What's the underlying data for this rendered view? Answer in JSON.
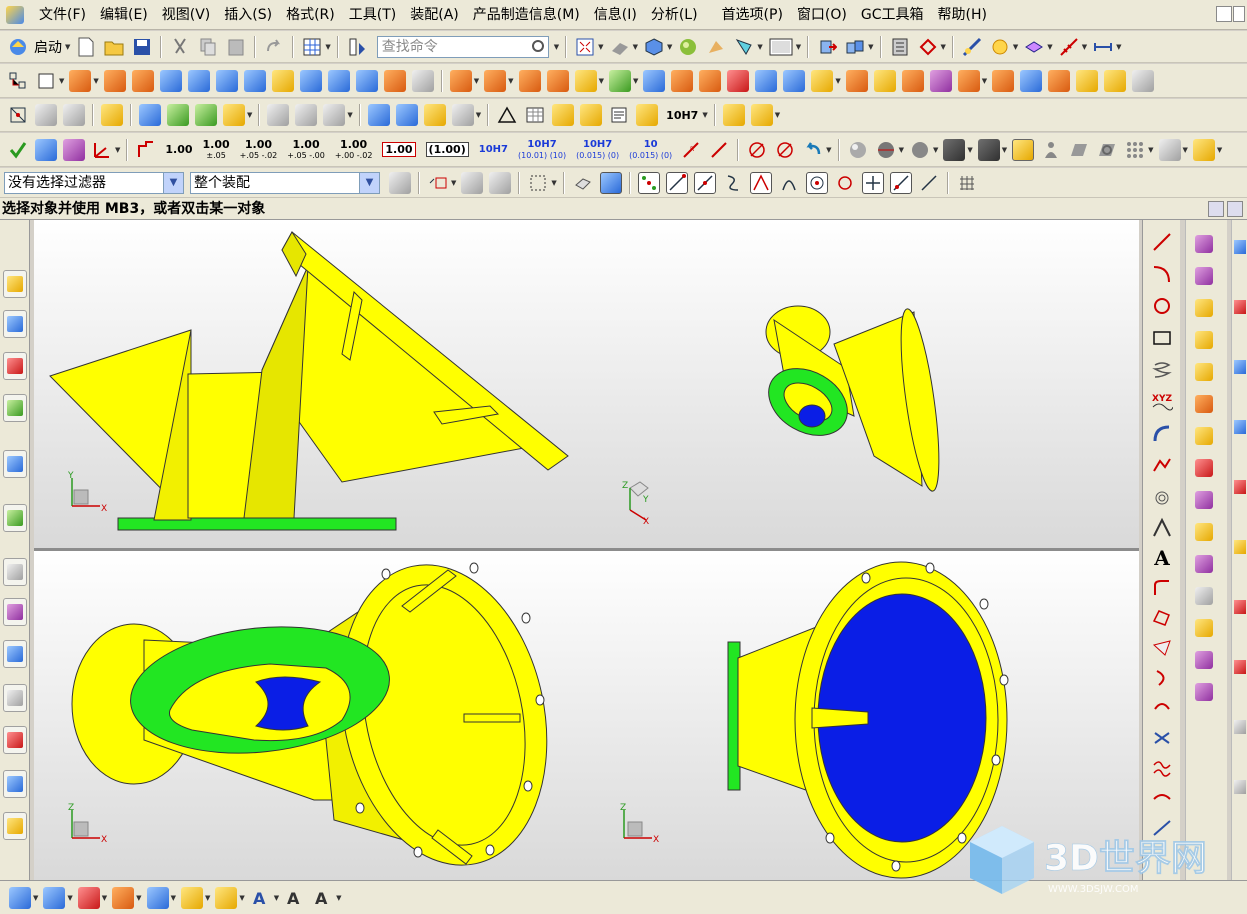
{
  "menubar": {
    "items": [
      "文件(F)",
      "编辑(E)",
      "视图(V)",
      "插入(S)",
      "格式(R)",
      "工具(T)",
      "装配(A)",
      "产品制造信息(M)",
      "信息(I)",
      "分析(L)",
      "首选项(P)",
      "窗口(O)",
      "GC工具箱",
      "帮助(H)"
    ]
  },
  "standard_toolbar": {
    "start_label": "启动",
    "search_placeholder": "查找命令"
  },
  "dimension_toolbar": {
    "labels": [
      "1.00",
      "1.00",
      "1.00",
      "1.00",
      "1.00",
      "1.00",
      "(1.00)",
      "10H7",
      "10H7",
      "10H7",
      "10"
    ],
    "sublabels": [
      "",
      "±.05",
      "+.05 -.02",
      "+.05 -.00",
      "+.00 -.02",
      "",
      "",
      "",
      "(10.01) (10)",
      "(0.015) (0)",
      "(0.015) (0)"
    ],
    "callout_label": "10H7"
  },
  "selection_bar": {
    "filter_value": "没有选择过滤器",
    "scope_value": "整个装配"
  },
  "cue_line": {
    "text": "选择对象并使用 MB3，或者双击某一对象"
  },
  "viewport": {
    "triad_labels": {
      "top_left": [
        "Y",
        "X"
      ],
      "top_right": [
        "Z",
        "Y",
        "X"
      ],
      "bottom_left": [
        "Z",
        "X"
      ],
      "bottom_right": [
        "Z",
        "X"
      ]
    }
  },
  "right_toolbar": {
    "text_tool_glyph": "A",
    "xyz_label": "XYZ"
  },
  "watermark": {
    "main": "3D世界网",
    "sub": "WWW.3DSJW.COM"
  },
  "colors": {
    "menu_bg": "#ece9d8",
    "part_yellow": "#ffff00",
    "part_green": "#22e622",
    "part_blue": "#0a1ee6",
    "viewport_top": "#ffffff",
    "viewport_bottom": "#d9d9d9"
  }
}
